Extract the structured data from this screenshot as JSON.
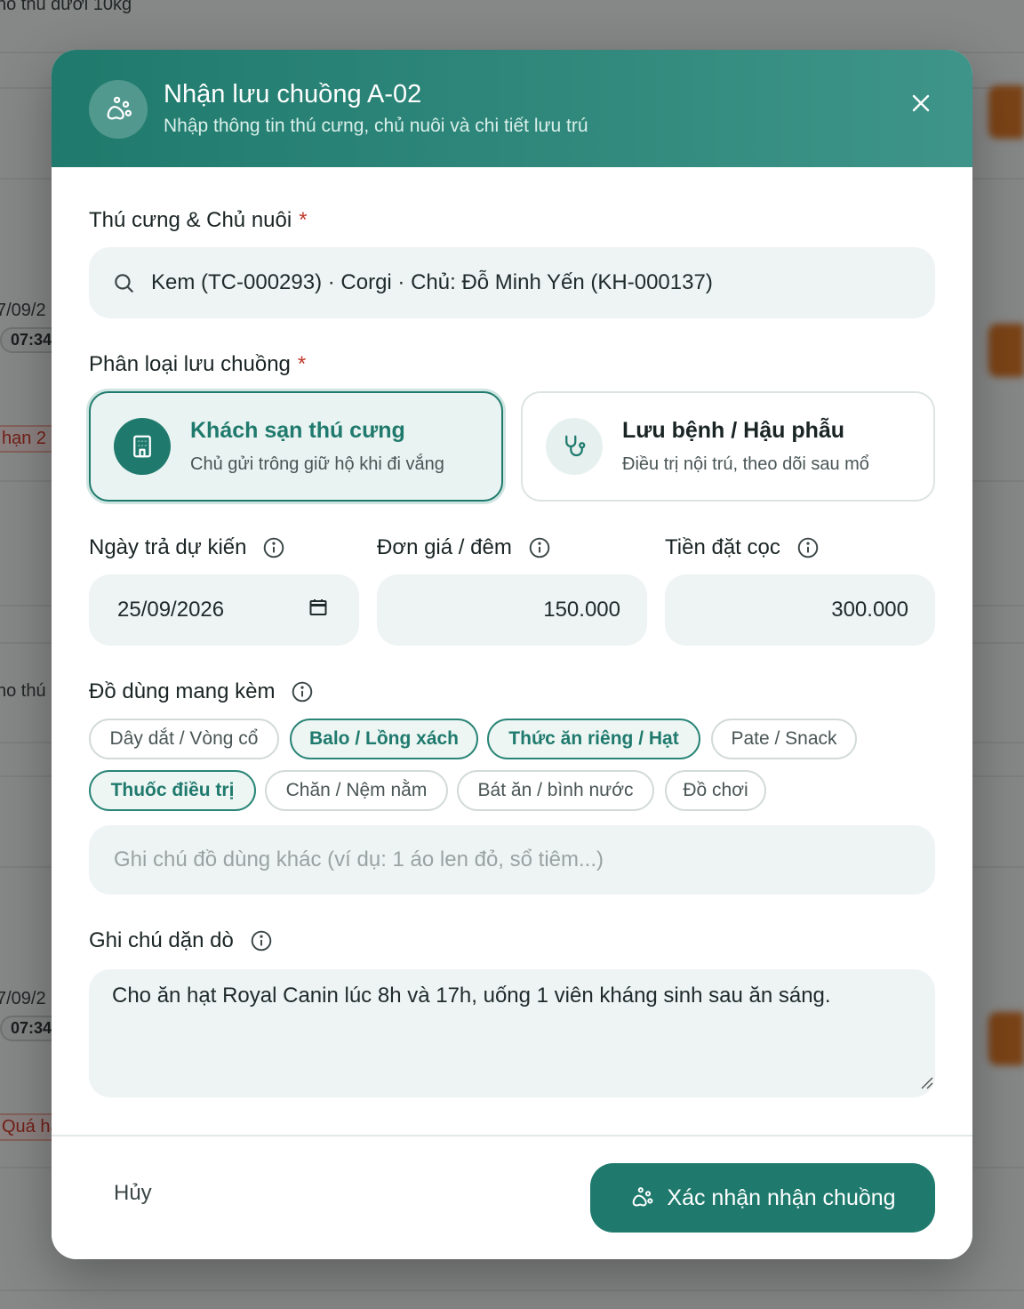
{
  "background": {
    "fragments": [
      "ho thú dưới 10kg",
      "7/09/2",
      "07:34",
      "hạn 2",
      "ho thú",
      "7/09/2",
      "07:34",
      "Quá hạ"
    ]
  },
  "modal": {
    "title": "Nhận lưu chuồng A-02",
    "subtitle": "Nhập thông tin thú cưng, chủ nuôi và chi tiết lưu trú",
    "header_icon": "paw-icon",
    "close_icon": "close-icon"
  },
  "pet_owner": {
    "label": "Thú cưng & Chủ nuôi",
    "required_mark": "*",
    "value": "Kem (TC-000293) · Corgi · Chủ: Đỗ Minh Yến (KH-000137)"
  },
  "boarding_type": {
    "label": "Phân loại lưu chuồng",
    "required_mark": "*",
    "options": [
      {
        "title": "Khách sạn thú cưng",
        "desc": "Chủ gửi trông giữ hộ khi đi vắng",
        "icon": "building-icon",
        "selected": true
      },
      {
        "title": "Lưu bệnh / Hậu phẫu",
        "desc": "Điều trị nội trú, theo dõi sau mổ",
        "icon": "stethoscope-icon",
        "selected": false
      }
    ]
  },
  "fields": {
    "return_date": {
      "label": "Ngày trả dự kiến",
      "value": "25/09/2026"
    },
    "price": {
      "label": "Đơn giá / đêm",
      "value": "150.000"
    },
    "deposit": {
      "label": "Tiền đặt cọc",
      "value": "300.000"
    }
  },
  "belongings": {
    "label": "Đồ dùng mang kèm",
    "chips": [
      {
        "label": "Dây dắt / Vòng cổ",
        "selected": false
      },
      {
        "label": "Balo / Lồng xách",
        "selected": true
      },
      {
        "label": "Thức ăn riêng / Hạt",
        "selected": true
      },
      {
        "label": "Pate / Snack",
        "selected": false
      },
      {
        "label": "Thuốc điều trị",
        "selected": true
      },
      {
        "label": "Chăn / Nệm nằm",
        "selected": false
      },
      {
        "label": "Bát ăn / bình nước",
        "selected": false
      },
      {
        "label": "Đồ chơi",
        "selected": false
      }
    ],
    "other_placeholder": "Ghi chú đồ dùng khác (ví dụ: 1 áo len đỏ, sổ tiêm...)"
  },
  "instructions": {
    "label": "Ghi chú dặn dò",
    "value": "Cho ăn hạt Royal Canin lúc 8h và 17h, uống 1 viên kháng sinh sau ăn sáng."
  },
  "footer": {
    "cancel_label": "Hủy",
    "confirm_label": "Xác nhận nhận chuồng"
  },
  "colors": {
    "primary": "#1f7a6d",
    "header_gradient_end": "#3e9488",
    "field_bg": "#eef4f3",
    "required": "#c0392b"
  }
}
